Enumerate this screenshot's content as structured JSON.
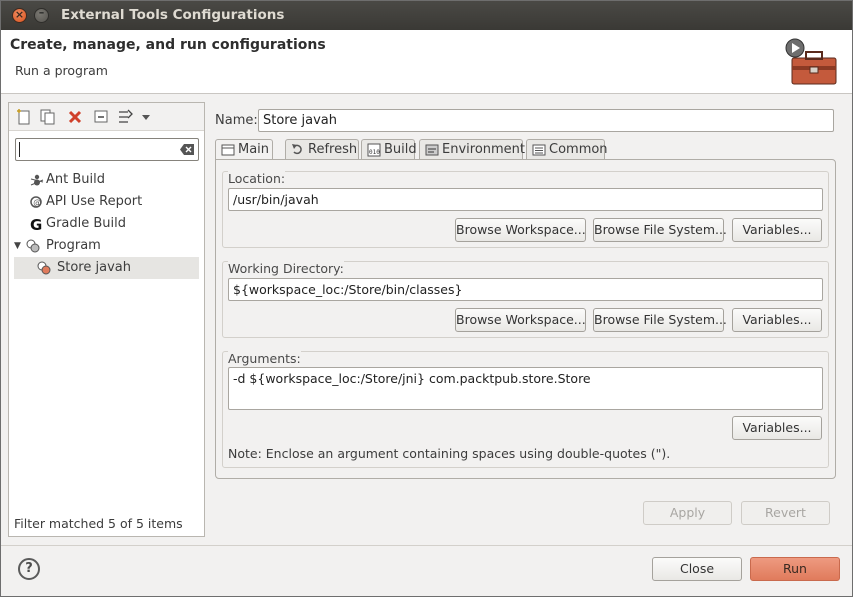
{
  "window": {
    "title": "External Tools Configurations"
  },
  "header": {
    "title": "Create, manage, and run configurations",
    "subtitle": "Run a program"
  },
  "left_panel": {
    "toolbar": [
      "new-config-icon",
      "duplicate-icon",
      "delete-icon",
      "collapse-all-icon",
      "filter-icon",
      "view-menu-icon"
    ],
    "filter_value": "",
    "tree": [
      {
        "label": "Ant Build",
        "icon": "ant-icon"
      },
      {
        "label": "API Use Report",
        "icon": "api-report-icon"
      },
      {
        "label": "Gradle Build",
        "icon": "gradle-icon"
      },
      {
        "label": "Program",
        "icon": "program-icon",
        "expanded": true
      },
      {
        "label": "Store javah",
        "icon": "program-config-icon",
        "selected": true
      }
    ],
    "status": "Filter matched 5 of 5 items"
  },
  "config": {
    "name_label": "Name:",
    "name_value": "Store javah",
    "tabs": [
      "Main",
      "Refresh",
      "Build",
      "Environment",
      "Common"
    ],
    "active_tab": "Main",
    "location": {
      "label": "Location:",
      "value": "/usr/bin/javah"
    },
    "working_directory": {
      "label": "Working Directory:",
      "value": "${workspace_loc:/Store/bin/classes}"
    },
    "arguments": {
      "label": "Arguments:",
      "value": "-d ${workspace_loc:/Store/jni} com.packtpub.store.Store",
      "note": "Note: Enclose an argument containing spaces using double-quotes (\")."
    },
    "buttons": {
      "browse_workspace": "Browse Workspace...",
      "browse_file_system": "Browse File System...",
      "variables": "Variables...",
      "apply": "Apply",
      "revert": "Revert"
    }
  },
  "footer": {
    "close": "Close",
    "run": "Run"
  },
  "colors": {
    "run_button": "#e07b5c",
    "title_bar": "#3c3b37",
    "close_window": "#df5b24"
  }
}
